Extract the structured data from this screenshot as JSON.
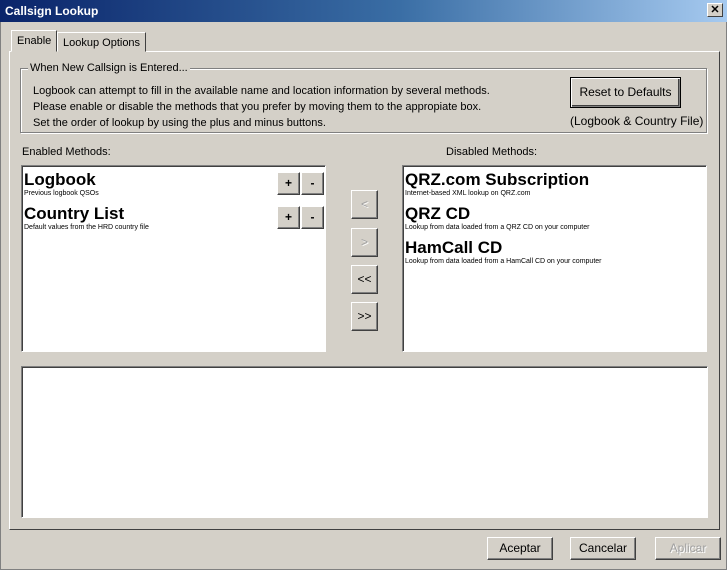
{
  "window": {
    "title": "Callsign Lookup",
    "close_glyph": "✕"
  },
  "tabs": [
    {
      "label": "Enable"
    },
    {
      "label": "Lookup Options"
    }
  ],
  "group": {
    "label": "When New Callsign is Entered...",
    "lines": [
      "Logbook can attempt to fill in the available name and location information by several methods.",
      "Please enable or disable the methods that you prefer by moving them to the appropiate box.",
      "Set the order of lookup by using the plus and minus buttons."
    ],
    "reset_label": "Reset to Defaults",
    "reset_note": "(Logbook & Country File)"
  },
  "enabled": {
    "label": "Enabled Methods:",
    "items": [
      {
        "title": "Logbook",
        "desc": "Previous logbook QSOs"
      },
      {
        "title": "Country List",
        "desc": "Default values from the HRD country file"
      }
    ],
    "plus": "+",
    "minus": "-"
  },
  "disabled": {
    "label": "Disabled Methods:",
    "items": [
      {
        "title": "QRZ.com Subscription",
        "desc": "Internet-based XML lookup on QRZ.com"
      },
      {
        "title": "QRZ CD",
        "desc": "Lookup from data loaded from a QRZ CD on your computer"
      },
      {
        "title": "HamCall CD",
        "desc": "Lookup from data loaded from a HamCall CD on your computer"
      }
    ]
  },
  "transfer": {
    "move_left": "<",
    "move_right": ">",
    "move_all_left": "<<",
    "move_all_right": ">>"
  },
  "footer": {
    "ok": "Aceptar",
    "cancel": "Cancelar",
    "apply": "Aplicar"
  }
}
